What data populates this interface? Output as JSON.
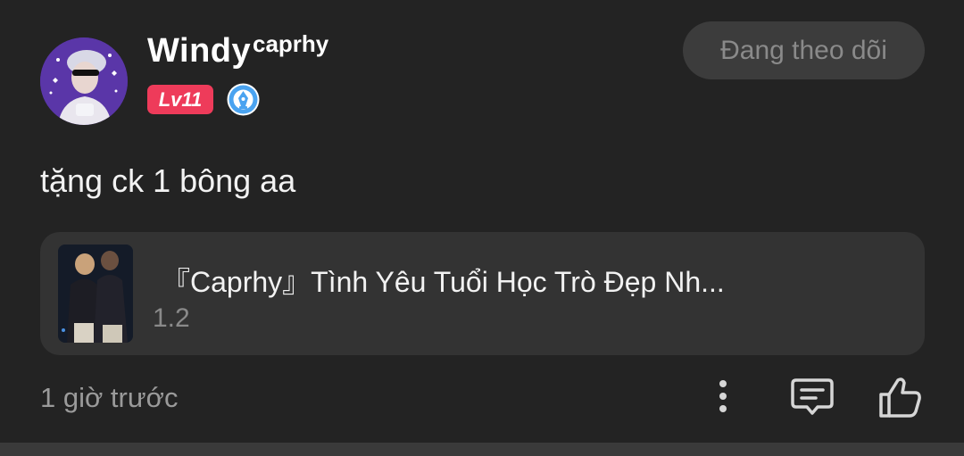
{
  "comment": {
    "author": {
      "name": "Windy",
      "tag": "caprhy",
      "level": "Lv11",
      "avatar_icon": "user-avatar",
      "badge_icon": "creator-pen-icon"
    },
    "follow_button_label": "Đang theo dõi",
    "text": "tặng ck 1 bông aa",
    "linked_video": {
      "title": "『Caprhy』Tình Yêu Tuổi Học Trò Đẹp Nh...",
      "subtitle": "1.2",
      "thumbnail_icon": "video-thumbnail"
    },
    "timestamp": "1 giờ trước",
    "actions": {
      "more_icon": "more-vertical-icon",
      "reply_icon": "comment-icon",
      "like_icon": "thumbs-up-icon"
    }
  },
  "colors": {
    "background": "#232323",
    "card": "#333333",
    "level_badge": "#ee3b5a",
    "pen_badge": "#4aa3f0",
    "muted_text": "#8a8a8a"
  }
}
